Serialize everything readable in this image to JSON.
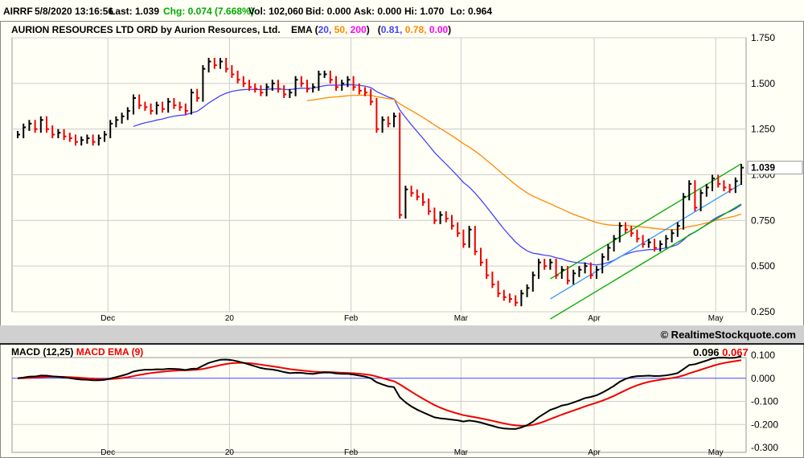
{
  "quote": {
    "symbol": "AIRRF",
    "datetime": "5/8/2020 13:16:56",
    "last": "Last: 1.039",
    "chg": "Chg: 0.074 (7.668%)",
    "vol": "Vol: 102,060",
    "bid": "Bid: 0.000",
    "ask": "Ask: 0.000",
    "hi": "Hi: 1.070",
    "lo": "Lo: 0.964"
  },
  "header": {
    "name": "AURION RESOURCES LTD ORD by Aurion Resources, Ltd.",
    "ema_label": "EMA (",
    "ema20": "20,",
    "ema50": "50,",
    "ema200": "200",
    "ema_close": ")",
    "open2": "(",
    "v20": "0.81,",
    "v50": "0.78,",
    "v200": "0.00",
    "close2": ")"
  },
  "copyright": "© RealtimeStockquote.com",
  "colors": {
    "ema20": "#4444ff",
    "ema50": "#ff8800",
    "ema200": "#ff00ff",
    "up": "#000000",
    "down": "#ee0000",
    "channel": "#00aa00",
    "midline": "#3399ff",
    "macd": "#000000",
    "signal": "#ee0000",
    "zero": "#4444ff",
    "chg": "#00aa00"
  },
  "chart_data": [
    {
      "type": "ohlc",
      "title": "AIRRF daily",
      "ylim": [
        0.25,
        1.75
      ],
      "yticks": [
        "1.750",
        "1.500",
        "1.250",
        "1.000",
        "0.750",
        "0.500",
        "0.250"
      ],
      "ytick_values": [
        1.75,
        1.5,
        1.25,
        1.0,
        0.75,
        0.5,
        0.25
      ],
      "xticks": [
        {
          "label": "Dec",
          "index": 16
        },
        {
          "label": "20",
          "index": 37
        },
        {
          "label": "Feb",
          "index": 58
        },
        {
          "label": "Mar",
          "index": 77
        },
        {
          "label": "Apr",
          "index": 100
        },
        {
          "label": "May",
          "index": 121
        }
      ],
      "last_label": "1.039",
      "closes": [
        1.22,
        1.26,
        1.28,
        1.25,
        1.3,
        1.25,
        1.22,
        1.23,
        1.21,
        1.2,
        1.18,
        1.19,
        1.2,
        1.18,
        1.2,
        1.22,
        1.28,
        1.3,
        1.32,
        1.35,
        1.42,
        1.38,
        1.37,
        1.35,
        1.38,
        1.36,
        1.4,
        1.38,
        1.37,
        1.35,
        1.45,
        1.42,
        1.58,
        1.62,
        1.6,
        1.62,
        1.58,
        1.55,
        1.52,
        1.5,
        1.48,
        1.47,
        1.45,
        1.48,
        1.5,
        1.47,
        1.44,
        1.45,
        1.52,
        1.5,
        1.47,
        1.48,
        1.55,
        1.55,
        1.52,
        1.48,
        1.5,
        1.52,
        1.48,
        1.46,
        1.45,
        1.4,
        1.25,
        1.3,
        1.28,
        1.32,
        0.78,
        0.92,
        0.9,
        0.88,
        0.85,
        0.8,
        0.75,
        0.78,
        0.76,
        0.72,
        0.68,
        0.62,
        0.7,
        0.58,
        0.52,
        0.45,
        0.4,
        0.35,
        0.33,
        0.32,
        0.3,
        0.35,
        0.38,
        0.45,
        0.52,
        0.5,
        0.52,
        0.45,
        0.48,
        0.42,
        0.46,
        0.48,
        0.5,
        0.45,
        0.48,
        0.55,
        0.6,
        0.65,
        0.72,
        0.7,
        0.68,
        0.65,
        0.62,
        0.63,
        0.6,
        0.62,
        0.65,
        0.68,
        0.72,
        0.88,
        0.95,
        0.82,
        0.9,
        0.93,
        0.98,
        0.95,
        0.93,
        0.92,
        0.965,
        1.039
      ],
      "trendlines": [
        {
          "name": "upper-channel",
          "from": [
            92,
            0.43
          ],
          "to": [
            125,
            1.06
          ],
          "color": "channel"
        },
        {
          "name": "mid-channel",
          "from": [
            92,
            0.32
          ],
          "to": [
            125,
            0.95
          ],
          "color": "midline"
        },
        {
          "name": "lower-channel",
          "from": [
            92,
            0.21
          ],
          "to": [
            125,
            0.84
          ],
          "color": "channel"
        }
      ]
    },
    {
      "type": "line",
      "title": "MACD (12,25)",
      "signal_title": "MACD EMA (9)",
      "macd_value": "0.096",
      "signal_value": "0.067",
      "ylim": [
        -0.3,
        0.1
      ],
      "yticks": [
        "0.100",
        "0.000",
        "-0.100",
        "-0.200",
        "-0.300"
      ],
      "ytick_values": [
        0.1,
        0,
        -0.1,
        -0.2,
        -0.3
      ]
    }
  ]
}
